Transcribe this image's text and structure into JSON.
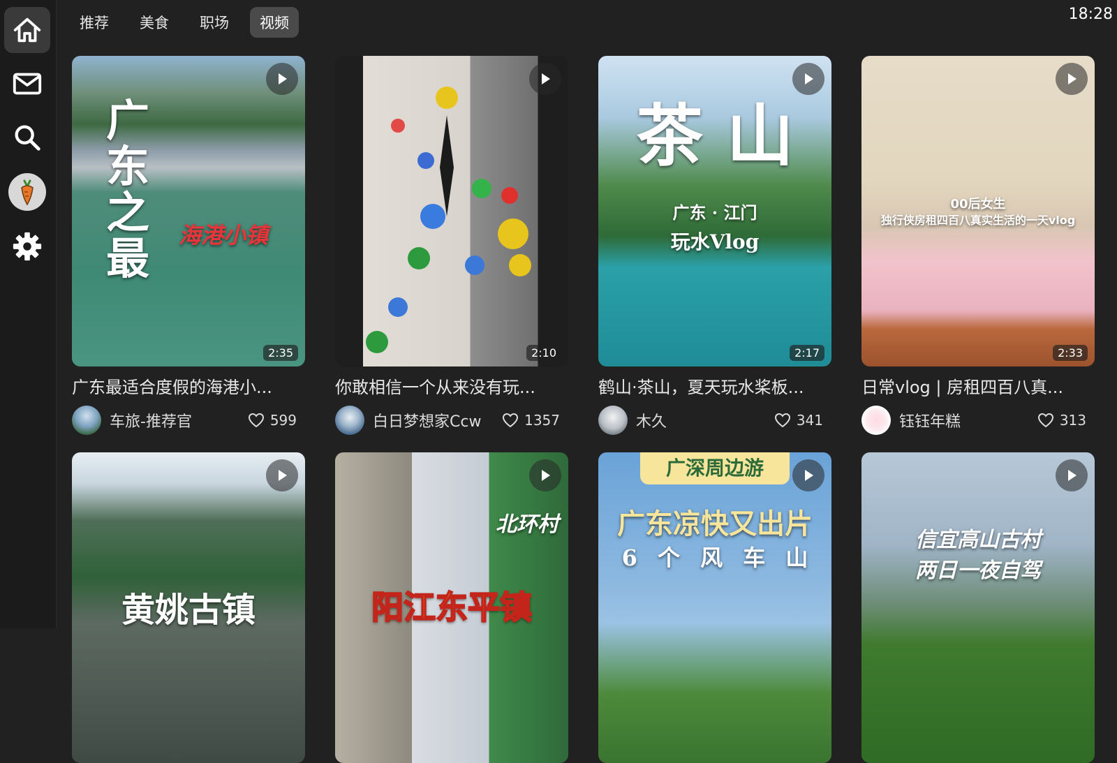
{
  "tabs": [
    {
      "label": "推荐",
      "active": false
    },
    {
      "label": "美食",
      "active": false
    },
    {
      "label": "职场",
      "active": false
    },
    {
      "label": "视频",
      "active": true
    }
  ],
  "clock": "18:28",
  "sidebar": {
    "items": [
      "home-icon",
      "mail-icon",
      "search-icon",
      "carrot-avatar",
      "gear-icon"
    ]
  },
  "videos": [
    {
      "duration": "2:35",
      "title": "广东最适合度假的海港小...",
      "author": "车旅-推荐官",
      "likes": "599",
      "overlay_lines": [
        "广东之最",
        "海港小镇"
      ]
    },
    {
      "duration": "2:10",
      "title": "你敢相信一个从来没有玩...",
      "author": "白日梦想家Ccw",
      "likes": "1357",
      "overlay_lines": []
    },
    {
      "duration": "2:17",
      "title": "鹤山·茶山，夏天玩水桨板...",
      "author": "木久",
      "likes": "341",
      "overlay_lines": [
        "茶 山",
        "广东 · 江门",
        "玩水Vlog"
      ]
    },
    {
      "duration": "2:33",
      "title": "日常vlog | 房租四百八真...",
      "author": "钰钰年糕",
      "likes": "313",
      "overlay_lines": [
        "00后女生",
        "独行侠房租四百八真实生活的一天vlog"
      ]
    },
    {
      "overlay_lines": [
        "黄姚古镇"
      ]
    },
    {
      "overlay_lines": [
        "北环村",
        "阳江东平镇"
      ]
    },
    {
      "overlay_lines": [
        "广深周边游",
        "广东凉快又出片",
        "6 个 风 车 山"
      ]
    },
    {
      "overlay_lines": [
        "信宜高山古村",
        "两日一夜自驾"
      ]
    }
  ]
}
